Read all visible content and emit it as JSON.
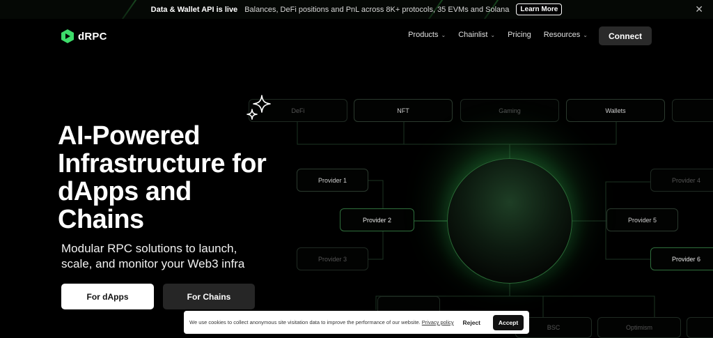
{
  "announcement": {
    "title": "Data & Wallet API is live",
    "description": "Balances, DeFi positions and PnL across 8K+ protocols, 35 EVMs and Solana",
    "cta": "Learn More",
    "close_glyph": "✕"
  },
  "nav": {
    "logo_text": "dRPC",
    "items": [
      {
        "label": "Products",
        "has_dropdown": true
      },
      {
        "label": "Chainlist",
        "has_dropdown": true
      },
      {
        "label": "Pricing",
        "has_dropdown": false
      },
      {
        "label": "Resources",
        "has_dropdown": true
      }
    ],
    "connect_label": "Connect"
  },
  "hero": {
    "title": "AI-Powered Infrastructure for dApps and Chains",
    "subtitle": "Modular RPC solutions to launch, scale, and monitor your Web3 infra",
    "btn_dapps": "For dApps",
    "btn_chains": "For Chains"
  },
  "diagram": {
    "top_categories": [
      "DeFi",
      "NFT",
      "Gaming",
      "Wallets"
    ],
    "providers_left": [
      "Provider 1",
      "Provider 2",
      "Provider 3"
    ],
    "providers_right": [
      "Provider 4",
      "Provider 5",
      "Provider 6"
    ],
    "bottom_chains": [
      "BSC",
      "Optimism"
    ]
  },
  "cookie": {
    "message": "We use cookies to collect anonymous site visitation data to improve the performance of our website.",
    "policy_link": "Privacy policy",
    "reject": "Reject",
    "accept": "Accept"
  },
  "colors": {
    "accent_green": "#3ddc6a",
    "background": "#000000"
  }
}
